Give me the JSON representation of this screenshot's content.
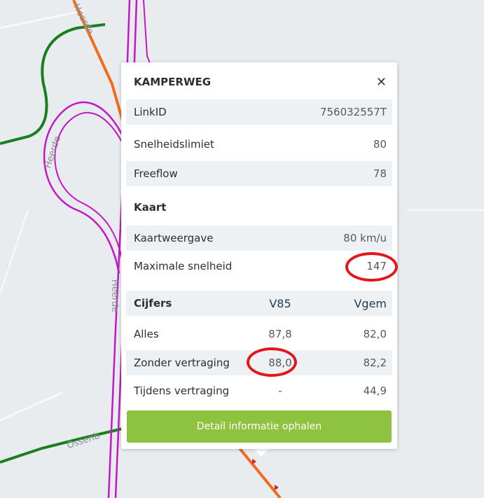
{
  "map": {
    "roads": {
      "highway_color": "#c218c8",
      "speed_slow_color": "#1a7f1f",
      "speed_mid_color": "#f26b1d"
    },
    "labels": {
      "top": "Heerde",
      "left": "Heerde",
      "middle": "Heerde",
      "bottom": "Ossenb"
    }
  },
  "popup": {
    "title": "KAMPERWEG",
    "close_icon": "close-icon",
    "rows": [
      {
        "label": "LinkID",
        "value": "756032557T"
      },
      {
        "label": "Snelheidslimiet",
        "value": "80"
      },
      {
        "label": "Freeflow",
        "value": "78"
      }
    ],
    "kaart": {
      "heading": "Kaart",
      "rows": [
        {
          "label": "Kaartweergave",
          "value": "80 km/u"
        },
        {
          "label": "Maximale snelheid",
          "value": "147"
        }
      ]
    },
    "cijfers": {
      "heading": "Cijfers",
      "col_v85": "V85",
      "col_vgem": "Vgem",
      "rows": [
        {
          "label": "Alles",
          "v85": "87,8",
          "vgem": "82,0"
        },
        {
          "label": "Zonder vertraging",
          "v85": "88,0",
          "vgem": "82,2"
        },
        {
          "label": "Tijdens vertraging",
          "v85": "-",
          "vgem": "44,9"
        }
      ]
    },
    "button_label": "Detail informatie ophalen",
    "button_color": "#8dc33f",
    "annotation_color": "#e3161b"
  }
}
